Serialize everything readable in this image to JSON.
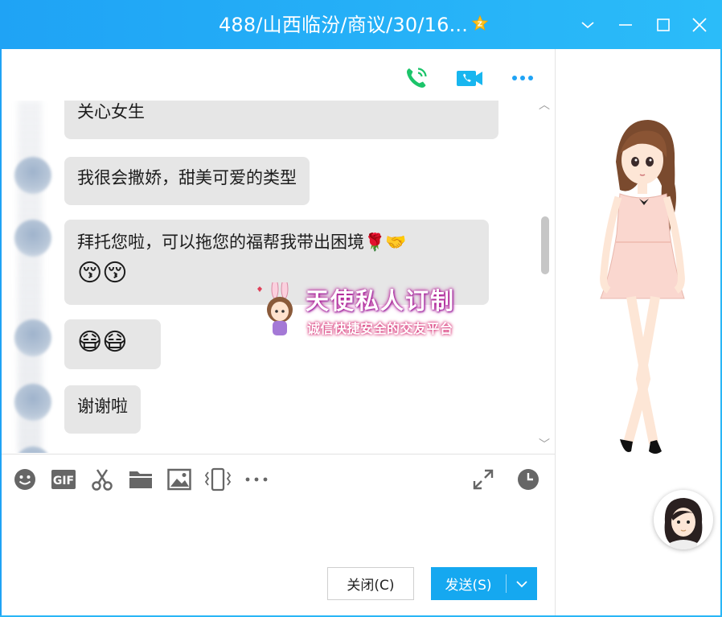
{
  "window": {
    "title": "488/山西临汾/商议/30/16...",
    "accent_color": "#1fa3f5",
    "controls": [
      "chevron-down-icon",
      "minimize-icon",
      "maximize-icon",
      "close-icon"
    ]
  },
  "header_actions": [
    "voice-call-icon",
    "video-call-icon",
    "more-icon"
  ],
  "messages": [
    {
      "text": "关心女生"
    },
    {
      "text": "我很会撒娇，甜美可爱的类型"
    },
    {
      "text": "拜托您啦，可以拖您的福帮我带出困境🌹🤝",
      "emoji_line": "😚😚"
    },
    {
      "emoji_line": "😷😷"
    },
    {
      "text": "谢谢啦"
    }
  ],
  "watermark": {
    "title": "天使私人订制",
    "subtitle": "诚信快捷安全的交友平台"
  },
  "toolbar": [
    "emoji-icon",
    "gif-icon",
    "scissors-icon",
    "folder-icon",
    "image-icon",
    "shake-icon",
    "more-icon",
    "expand-icon",
    "history-clock-icon"
  ],
  "toolbar_gif_label": "GIF",
  "buttons": {
    "close": "关闭(C)",
    "send": "发送(S)"
  }
}
